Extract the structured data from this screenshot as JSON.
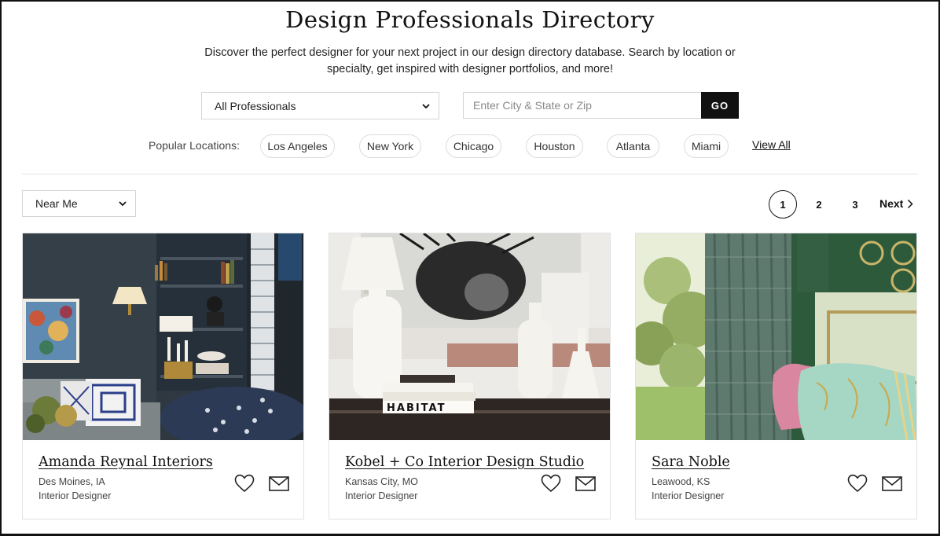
{
  "header": {
    "title": "Design Professionals Directory",
    "subtitle": "Discover the perfect designer for your next project in our design directory database. Search by location or specialty, get inspired with designer portfolios, and more!"
  },
  "search": {
    "professional_select": "All Professionals",
    "location_placeholder": "Enter City & State or Zip",
    "go_label": "GO"
  },
  "popular": {
    "label": "Popular Locations:",
    "locations": [
      "Los Angeles",
      "New York",
      "Chicago",
      "Houston",
      "Atlanta",
      "Miami"
    ],
    "view_all": "View All"
  },
  "sort": {
    "selected": "Near Me"
  },
  "pagination": {
    "pages": [
      "1",
      "2",
      "3"
    ],
    "active": "1",
    "next_label": "Next"
  },
  "cards": [
    {
      "name": "Amanda Reynal Interiors",
      "location": "Des Moines, IA",
      "type": "Interior Designer"
    },
    {
      "name": "Kobel + Co Interior Design Studio",
      "location": "Kansas City, MO",
      "type": "Interior Designer",
      "image_text": "HABITAT"
    },
    {
      "name": "Sara Noble",
      "location": "Leawood, KS",
      "type": "Interior Designer"
    }
  ],
  "icons": {
    "chevron": "chevron-down-icon",
    "next": "chevron-right-icon",
    "favorite": "heart-icon",
    "contact": "mail-icon"
  }
}
